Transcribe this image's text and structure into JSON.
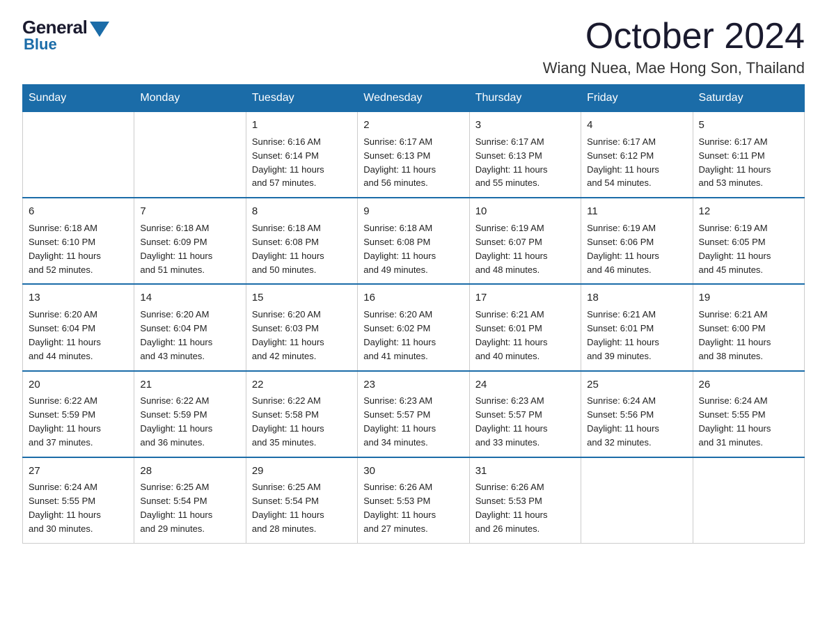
{
  "logo": {
    "general": "General",
    "blue": "Blue"
  },
  "header": {
    "month": "October 2024",
    "location": "Wiang Nuea, Mae Hong Son, Thailand"
  },
  "days_of_week": [
    "Sunday",
    "Monday",
    "Tuesday",
    "Wednesday",
    "Thursday",
    "Friday",
    "Saturday"
  ],
  "weeks": [
    [
      {
        "day": "",
        "info": ""
      },
      {
        "day": "",
        "info": ""
      },
      {
        "day": "1",
        "info": "Sunrise: 6:16 AM\nSunset: 6:14 PM\nDaylight: 11 hours\nand 57 minutes."
      },
      {
        "day": "2",
        "info": "Sunrise: 6:17 AM\nSunset: 6:13 PM\nDaylight: 11 hours\nand 56 minutes."
      },
      {
        "day": "3",
        "info": "Sunrise: 6:17 AM\nSunset: 6:13 PM\nDaylight: 11 hours\nand 55 minutes."
      },
      {
        "day": "4",
        "info": "Sunrise: 6:17 AM\nSunset: 6:12 PM\nDaylight: 11 hours\nand 54 minutes."
      },
      {
        "day": "5",
        "info": "Sunrise: 6:17 AM\nSunset: 6:11 PM\nDaylight: 11 hours\nand 53 minutes."
      }
    ],
    [
      {
        "day": "6",
        "info": "Sunrise: 6:18 AM\nSunset: 6:10 PM\nDaylight: 11 hours\nand 52 minutes."
      },
      {
        "day": "7",
        "info": "Sunrise: 6:18 AM\nSunset: 6:09 PM\nDaylight: 11 hours\nand 51 minutes."
      },
      {
        "day": "8",
        "info": "Sunrise: 6:18 AM\nSunset: 6:08 PM\nDaylight: 11 hours\nand 50 minutes."
      },
      {
        "day": "9",
        "info": "Sunrise: 6:18 AM\nSunset: 6:08 PM\nDaylight: 11 hours\nand 49 minutes."
      },
      {
        "day": "10",
        "info": "Sunrise: 6:19 AM\nSunset: 6:07 PM\nDaylight: 11 hours\nand 48 minutes."
      },
      {
        "day": "11",
        "info": "Sunrise: 6:19 AM\nSunset: 6:06 PM\nDaylight: 11 hours\nand 46 minutes."
      },
      {
        "day": "12",
        "info": "Sunrise: 6:19 AM\nSunset: 6:05 PM\nDaylight: 11 hours\nand 45 minutes."
      }
    ],
    [
      {
        "day": "13",
        "info": "Sunrise: 6:20 AM\nSunset: 6:04 PM\nDaylight: 11 hours\nand 44 minutes."
      },
      {
        "day": "14",
        "info": "Sunrise: 6:20 AM\nSunset: 6:04 PM\nDaylight: 11 hours\nand 43 minutes."
      },
      {
        "day": "15",
        "info": "Sunrise: 6:20 AM\nSunset: 6:03 PM\nDaylight: 11 hours\nand 42 minutes."
      },
      {
        "day": "16",
        "info": "Sunrise: 6:20 AM\nSunset: 6:02 PM\nDaylight: 11 hours\nand 41 minutes."
      },
      {
        "day": "17",
        "info": "Sunrise: 6:21 AM\nSunset: 6:01 PM\nDaylight: 11 hours\nand 40 minutes."
      },
      {
        "day": "18",
        "info": "Sunrise: 6:21 AM\nSunset: 6:01 PM\nDaylight: 11 hours\nand 39 minutes."
      },
      {
        "day": "19",
        "info": "Sunrise: 6:21 AM\nSunset: 6:00 PM\nDaylight: 11 hours\nand 38 minutes."
      }
    ],
    [
      {
        "day": "20",
        "info": "Sunrise: 6:22 AM\nSunset: 5:59 PM\nDaylight: 11 hours\nand 37 minutes."
      },
      {
        "day": "21",
        "info": "Sunrise: 6:22 AM\nSunset: 5:59 PM\nDaylight: 11 hours\nand 36 minutes."
      },
      {
        "day": "22",
        "info": "Sunrise: 6:22 AM\nSunset: 5:58 PM\nDaylight: 11 hours\nand 35 minutes."
      },
      {
        "day": "23",
        "info": "Sunrise: 6:23 AM\nSunset: 5:57 PM\nDaylight: 11 hours\nand 34 minutes."
      },
      {
        "day": "24",
        "info": "Sunrise: 6:23 AM\nSunset: 5:57 PM\nDaylight: 11 hours\nand 33 minutes."
      },
      {
        "day": "25",
        "info": "Sunrise: 6:24 AM\nSunset: 5:56 PM\nDaylight: 11 hours\nand 32 minutes."
      },
      {
        "day": "26",
        "info": "Sunrise: 6:24 AM\nSunset: 5:55 PM\nDaylight: 11 hours\nand 31 minutes."
      }
    ],
    [
      {
        "day": "27",
        "info": "Sunrise: 6:24 AM\nSunset: 5:55 PM\nDaylight: 11 hours\nand 30 minutes."
      },
      {
        "day": "28",
        "info": "Sunrise: 6:25 AM\nSunset: 5:54 PM\nDaylight: 11 hours\nand 29 minutes."
      },
      {
        "day": "29",
        "info": "Sunrise: 6:25 AM\nSunset: 5:54 PM\nDaylight: 11 hours\nand 28 minutes."
      },
      {
        "day": "30",
        "info": "Sunrise: 6:26 AM\nSunset: 5:53 PM\nDaylight: 11 hours\nand 27 minutes."
      },
      {
        "day": "31",
        "info": "Sunrise: 6:26 AM\nSunset: 5:53 PM\nDaylight: 11 hours\nand 26 minutes."
      },
      {
        "day": "",
        "info": ""
      },
      {
        "day": "",
        "info": ""
      }
    ]
  ]
}
